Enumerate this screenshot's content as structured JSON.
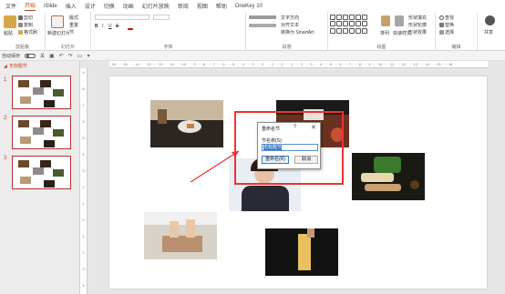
{
  "menu": {
    "tabs": [
      "文件",
      "开始",
      "iSlide",
      "插入",
      "设计",
      "切换",
      "动画",
      "幻灯片放映",
      "审阅",
      "视图",
      "帮助",
      "OneKey 10"
    ],
    "active": "开始"
  },
  "ribbon": {
    "clipboard": {
      "paste": "粘贴",
      "cut": "剪切",
      "copy": "复制",
      "painter": "格式刷",
      "label": "剪贴板"
    },
    "slides": {
      "new_slide": "新建幻灯片",
      "layout": "版式",
      "reset": "重置",
      "section": "节",
      "label": "幻灯片"
    },
    "font": {
      "label": "字体"
    },
    "paragraph": {
      "text_direction": "文字方向",
      "align_text": "对齐文本",
      "smartart": "转换为 SmartArt",
      "label": "段落"
    },
    "drawing": {
      "arrange": "排列",
      "quick_styles": "快速样式",
      "fill": "形状填充",
      "outline": "形状轮廓",
      "effects": "形状效果",
      "label": "绘图"
    },
    "editing": {
      "find": "查找",
      "replace": "替换",
      "select": "选择",
      "label": "编辑"
    },
    "share": "共享"
  },
  "qat": {
    "autosave": "自动保存",
    "autosave_state": "关"
  },
  "slide_panel": {
    "header": "无标题节",
    "slides": [
      {
        "num": "1"
      },
      {
        "num": "2"
      },
      {
        "num": "3"
      }
    ]
  },
  "dialog": {
    "title": "重命名节",
    "help": "?",
    "close": "✕",
    "label": "节名称(S):",
    "value": "无标题节",
    "rename_button": "重命名(R)",
    "cancel_button": "取消"
  },
  "colors": {
    "accent": "#c43e1c",
    "highlight": "#e33333",
    "selection": "#3a78c9"
  }
}
